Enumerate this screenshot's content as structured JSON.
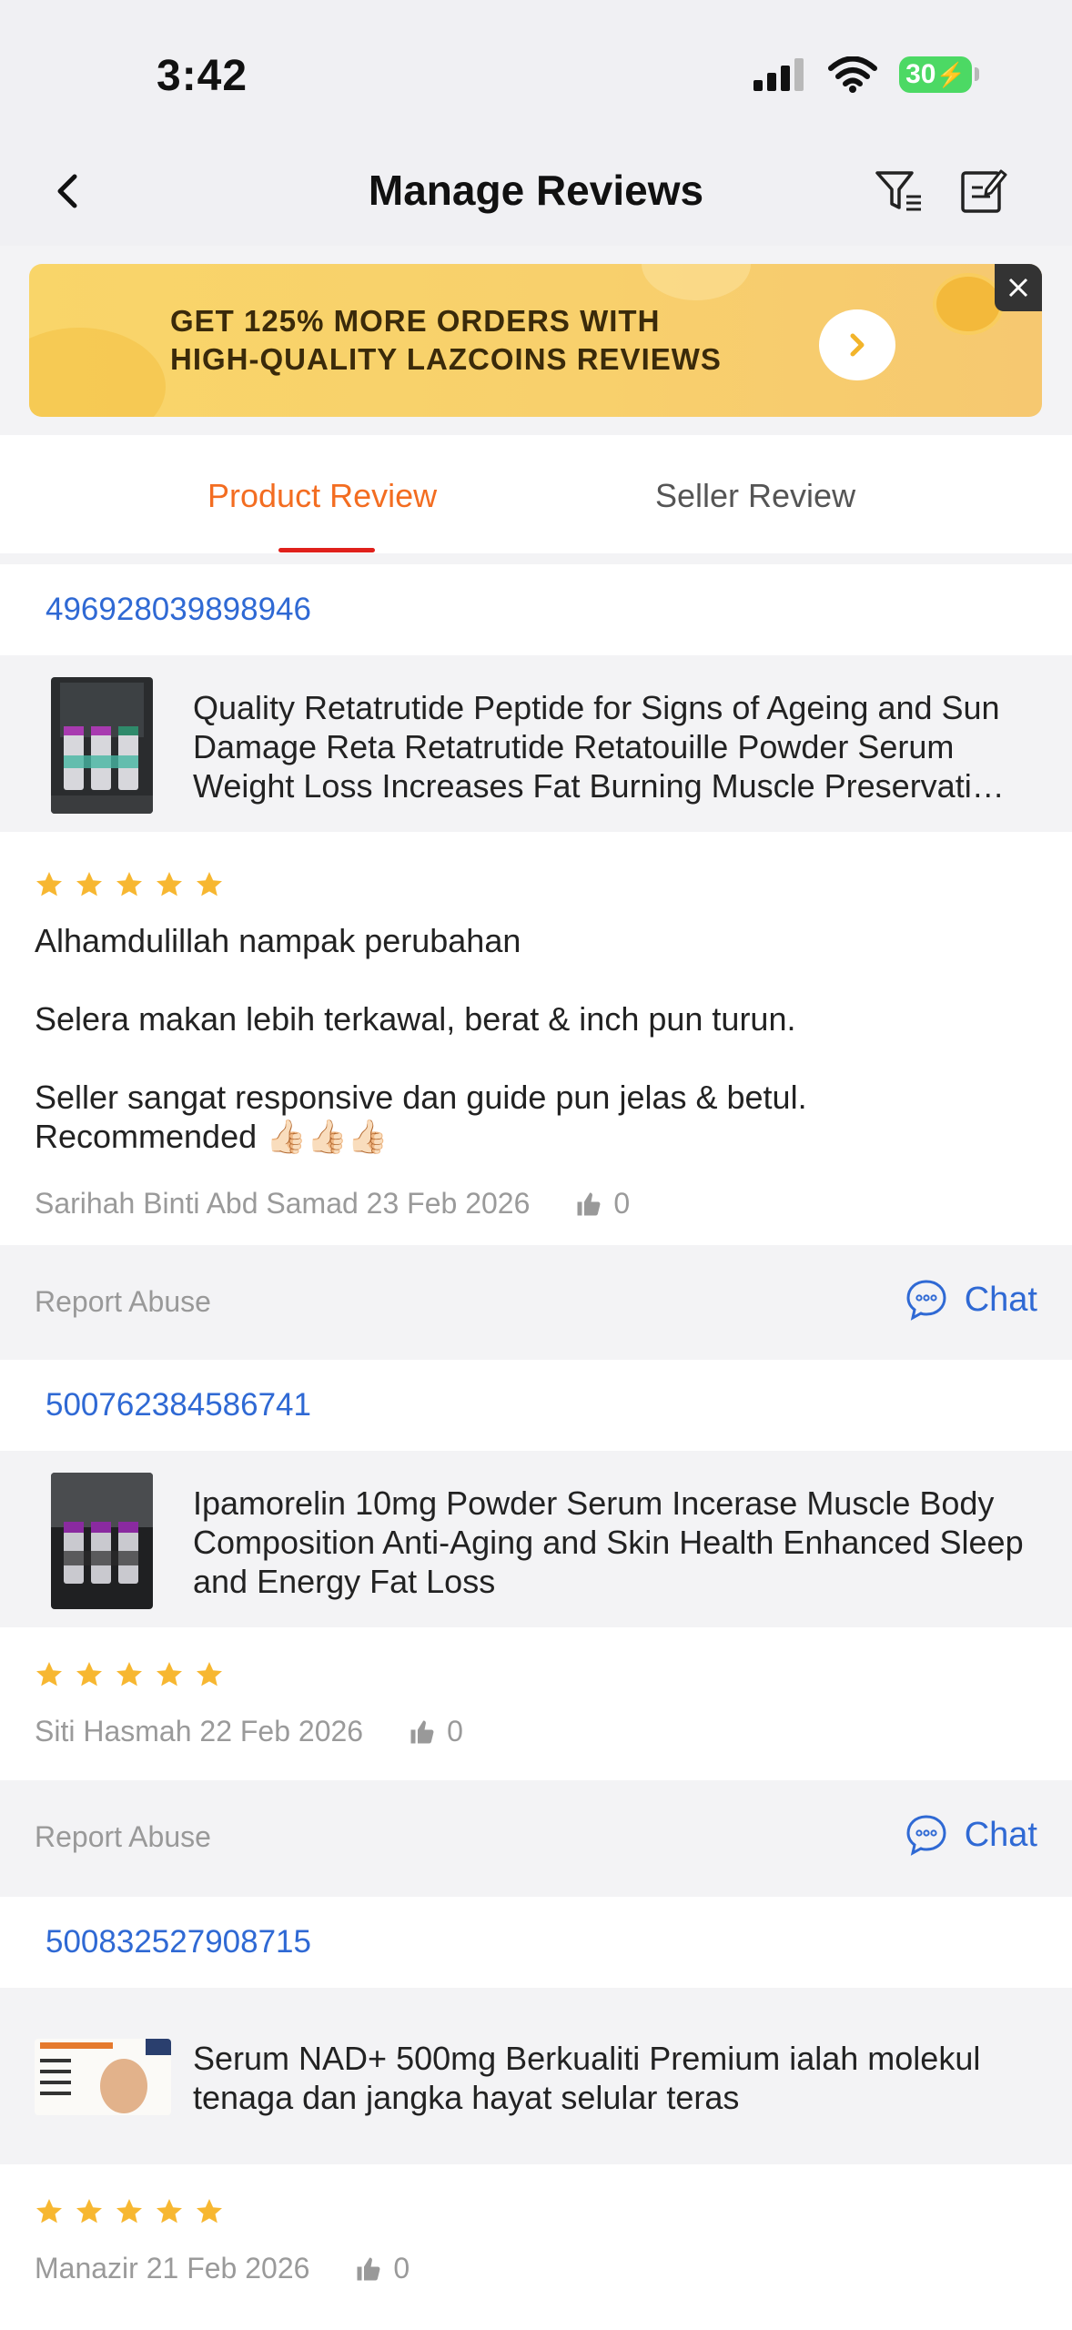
{
  "status": {
    "time": "3:42",
    "battery": "30"
  },
  "nav": {
    "title": "Manage Reviews"
  },
  "promo": {
    "line1": "GET 125% MORE ORDERS WITH",
    "line2": "HIGH-QUALITY LAZCOINS REVIEWS"
  },
  "tabs": {
    "product": "Product Review",
    "seller": "Seller Review"
  },
  "reviews": [
    {
      "order_id": "496928039898946",
      "product_title": "Quality Retatrutide Peptide for Signs of Ageing and Sun Damage Reta Retatrutide Retatouille Powder Serum Weight Loss Increases Fat Burning Muscle Preservati…",
      "rating": 5,
      "text": [
        "Alhamdulillah nampak perubahan",
        "Selera makan lebih terkawal, berat & inch pun turun.",
        "Seller sangat responsive dan guide pun jelas & betul.",
        "Recommended 👍🏻👍🏻👍🏻"
      ],
      "author_date": "Sarihah Binti Abd Samad 23 Feb 2026",
      "likes": "0",
      "report": "Report Abuse",
      "chat": "Chat"
    },
    {
      "order_id": "500762384586741",
      "product_title": "Ipamorelin 10mg Powder Serum Incerase Muscle Body Composition Anti-Aging and Skin Health Enhanced Sleep and Energy Fat Loss",
      "rating": 5,
      "author_date": "Siti Hasmah 22 Feb 2026",
      "likes": "0",
      "report": "Report Abuse",
      "chat": "Chat"
    },
    {
      "order_id": "500832527908715",
      "product_title": "Serum NAD+ 500mg Berkualiti Premium ialah molekul tenaga dan jangka hayat selular teras",
      "rating": 5,
      "author_date": "Manazir 21 Feb 2026",
      "likes": "0"
    }
  ],
  "colors": {
    "accent": "#f36d21",
    "link": "#2f69d4",
    "star": "#f7b731",
    "underline": "#e0201b"
  }
}
